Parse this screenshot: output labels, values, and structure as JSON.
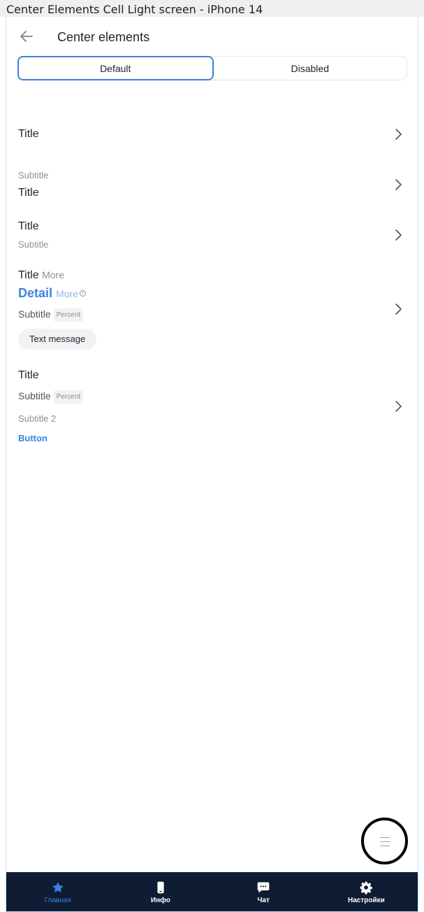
{
  "frame": {
    "title": "Center Elements Cell Light screen - iPhone 14"
  },
  "header": {
    "title": "Center elements",
    "back_icon": "arrow-left-icon"
  },
  "segmented": {
    "default_label": "Default",
    "disabled_label": "Disabled",
    "selected": "Default"
  },
  "cells": {
    "c1": {
      "title": "Title"
    },
    "c2": {
      "subtitle": "Subtitle",
      "title": "Title"
    },
    "c3": {
      "title": "Title",
      "subtitle": "Subtitle"
    },
    "c4": {
      "title": "Title",
      "title_more": "More",
      "detail": "Detail",
      "detail_more": "More",
      "info_glyph": "i",
      "subtitle": "Subtitle",
      "badge": "Percent",
      "pill": "Text message"
    },
    "c5": {
      "title": "Title",
      "subtitle": "Subtitle",
      "badge": "Percent",
      "subtitle2": "Subtitle 2",
      "button": "Button"
    }
  },
  "tabbar": {
    "tabs": [
      {
        "label": "Главная",
        "icon": "star-icon",
        "active": true
      },
      {
        "label": "Инфо",
        "icon": "phone-icon",
        "active": false
      },
      {
        "label": "Чат",
        "icon": "chat-icon",
        "active": false
      },
      {
        "label": "Настройки",
        "icon": "gear-icon",
        "active": false
      }
    ]
  },
  "colors": {
    "accent": "#3b82e0",
    "tabbar_bg": "#0f1c33",
    "muted": "#8a9099"
  }
}
